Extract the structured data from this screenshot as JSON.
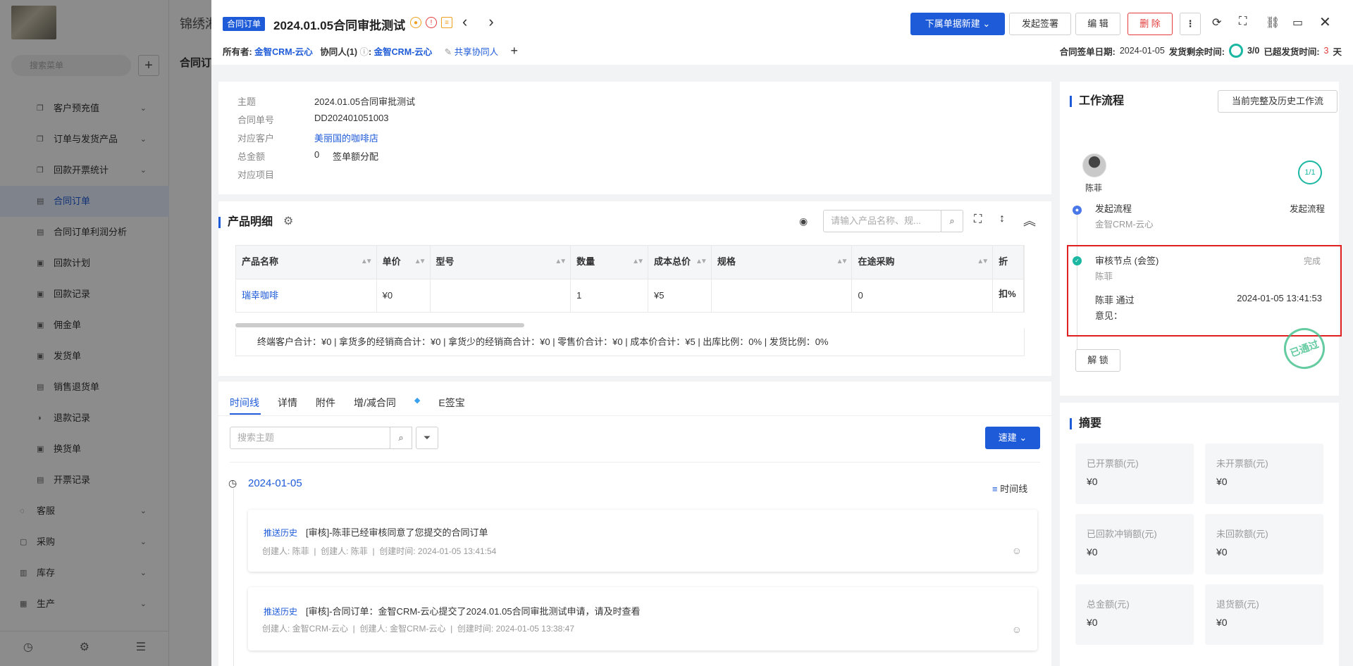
{
  "bg": {
    "brand": "锦绣湘",
    "search_placeholder": "搜索菜单",
    "tab_title": "合同订",
    "menu": [
      {
        "icon": "❐",
        "label": "客户预充值",
        "chev": "⌄"
      },
      {
        "icon": "❐",
        "label": "订单与发货产品",
        "chev": "⌄"
      },
      {
        "icon": "❐",
        "label": "回款开票统计",
        "chev": "⌄"
      },
      {
        "icon": "▤",
        "label": "合同订单",
        "chev": ""
      },
      {
        "icon": "▤",
        "label": "合同订单利润分析",
        "chev": ""
      },
      {
        "icon": "▣",
        "label": "回款计划",
        "chev": ""
      },
      {
        "icon": "▣",
        "label": "回款记录",
        "chev": ""
      },
      {
        "icon": "▣",
        "label": "佣金单",
        "chev": ""
      },
      {
        "icon": "▣",
        "label": "发货单",
        "chev": ""
      },
      {
        "icon": "▤",
        "label": "销售退货单",
        "chev": ""
      },
      {
        "icon": "◑",
        "label": "退款记录",
        "chev": ""
      },
      {
        "icon": "▣",
        "label": "换货单",
        "chev": ""
      },
      {
        "icon": "▤",
        "label": "开票记录",
        "chev": ""
      },
      {
        "icon": "◌",
        "label": "客服",
        "chev": "⌄"
      },
      {
        "icon": "▢",
        "label": "采购",
        "chev": "⌄"
      },
      {
        "icon": "▥",
        "label": "库存",
        "chev": "⌄"
      },
      {
        "icon": "▦",
        "label": "生产",
        "chev": "⌄"
      }
    ]
  },
  "header": {
    "tag": "合同订单",
    "title": "2024.01.05合同审批测试",
    "btn_new": "下属单据新建",
    "btn_sign": "发起签署",
    "btn_edit": "编 辑",
    "btn_delete": "删 除",
    "owner_label": "所有者:",
    "owner": "金智CRM-云心",
    "collab_label": "协同人(1)",
    "collab": "金智CRM-云心",
    "share": "共享协同人",
    "sign_date_label": "合同签单日期:",
    "sign_date": "2024-01-05",
    "ship_remaining_label": "发货剩余时间:",
    "ship_count": "3/0",
    "overdue_label": "已超发货时间:",
    "overdue_days": "3",
    "overdue_unit": "天"
  },
  "info": {
    "rows": [
      {
        "label": "主题",
        "value": "2024.01.05合同审批测试"
      },
      {
        "label": "合同单号",
        "value": "DD202401051003"
      },
      {
        "label": "对应客户",
        "value": "美丽国的咖啡店"
      },
      {
        "label": "总金额",
        "value": "0"
      },
      {
        "label": "对应项目",
        "value": ""
      }
    ],
    "sign_split": "签单额分配"
  },
  "products": {
    "title": "产品明细",
    "search_placeholder": "请输入产品名称、规...",
    "columns": [
      "产品名称",
      "单价",
      "型号",
      "数量",
      "成本总价",
      "规格",
      "在途采购",
      "折扣%"
    ],
    "row": [
      "瑞幸咖啡",
      "¥0",
      "",
      "1",
      "¥5",
      "",
      "0",
      ""
    ],
    "summary": "终端客户合计：¥0 |    拿货多的经销商合计：¥0 |    拿货少的经销商合计：¥0 |    零售价合计：¥0 |    成本价合计：¥5 |    出库比例：0% |    发货比例：0%"
  },
  "timeline": {
    "tabs": [
      "时间线",
      "详情",
      "附件",
      "增/减合同",
      "E签宝"
    ],
    "search_placeholder": "搜索主题",
    "quick_btn": "速建",
    "date": "2024-01-05",
    "view_label": "时间线",
    "items": [
      {
        "tag": "推送历史",
        "text": "[审核]-陈菲已经审核同意了您提交的合同订单",
        "creator": "创建人: 陈菲",
        "creator2": "创建人: 陈菲",
        "time": "创建时间: 2024-01-05 13:41:54"
      },
      {
        "tag": "推送历史",
        "text": "[审核]-合同订单：金智CRM-云心提交了2024.01.05合同审批测试申请，请及时查看",
        "creator": "创建人: 金智CRM-云心",
        "creator2": "创建人: 金智CRM-云心",
        "time": "创建时间: 2024-01-05 13:38:47"
      }
    ]
  },
  "workflow": {
    "title": "工作流程",
    "history_btn": "当前完整及历史工作流",
    "user": "陈菲",
    "counter": "1/1",
    "start_title": "发起流程",
    "start_sub": "金智CRM-云心",
    "start_right": "发起流程",
    "review_title": "审核节点 (会签)",
    "review_sub": "陈菲",
    "review_status": "完成",
    "approver": "陈菲 通过",
    "approve_time": "2024-01-05 13:41:53",
    "opinion": "意见：",
    "stamp": "已通过",
    "unlock": "解 锁"
  },
  "summary": {
    "title": "摘要",
    "boxes": [
      {
        "label": "已开票额(元)",
        "value": "¥0"
      },
      {
        "label": "未开票额(元)",
        "value": "¥0"
      },
      {
        "label": "已回款冲销额(元)",
        "value": "¥0"
      },
      {
        "label": "未回款额(元)",
        "value": "¥0"
      },
      {
        "label": "总金额(元)",
        "value": "¥0"
      },
      {
        "label": "退货额(元)",
        "value": "¥0"
      }
    ]
  },
  "colors": {
    "accent": "#1e5bd8",
    "danger": "#e23b3b",
    "teal": "#1bb7a3"
  }
}
